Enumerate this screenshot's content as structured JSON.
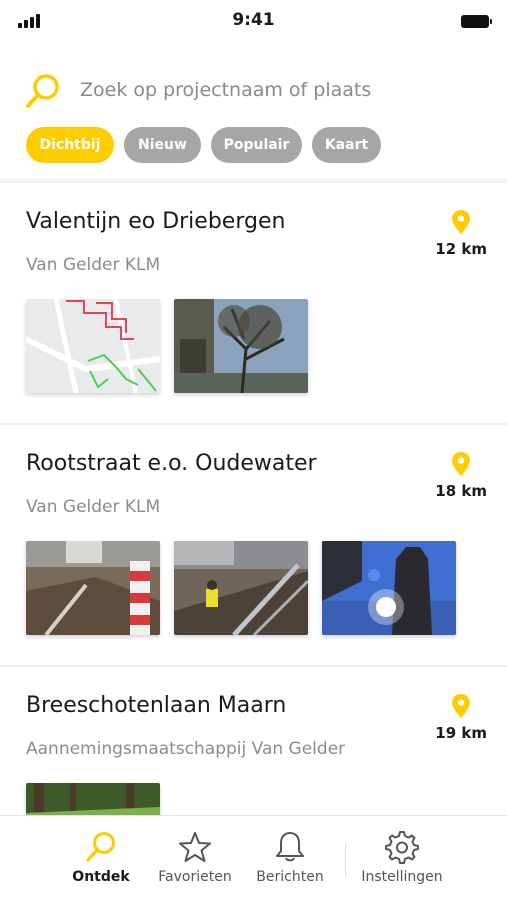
{
  "status_bar": {
    "time": "9:41"
  },
  "search": {
    "placeholder": "Zoek op projectnaam of plaats"
  },
  "filters": [
    "Dichtbij",
    "Nieuw",
    "Populair",
    "Kaart"
  ],
  "projects": [
    {
      "title": "Valentijn eo Driebergen",
      "company": "Van Gelder KLM",
      "distance": "12 km",
      "images": [
        "map-thumbnail",
        "tree-photo"
      ]
    },
    {
      "title": "Rootstraat e.o. Oudewater",
      "company": "Van Gelder KLM",
      "distance": "18 km",
      "images": [
        "construction-photo",
        "worker-trench-photo",
        "church-tower-photo"
      ]
    },
    {
      "title": "Breeschotenlaan Maarn",
      "company": "Aannemingsmaatschappij Van Gelder",
      "distance": "19 km",
      "images": [
        "forest-photo"
      ]
    }
  ],
  "tabs": [
    "Ontdek",
    "Favorieten",
    "Berichten",
    "Instellingen"
  ],
  "colors": {
    "accent": "#ffcc00",
    "chip_inactive": "#a6a6a6",
    "muted_text": "#8c8c8c"
  }
}
